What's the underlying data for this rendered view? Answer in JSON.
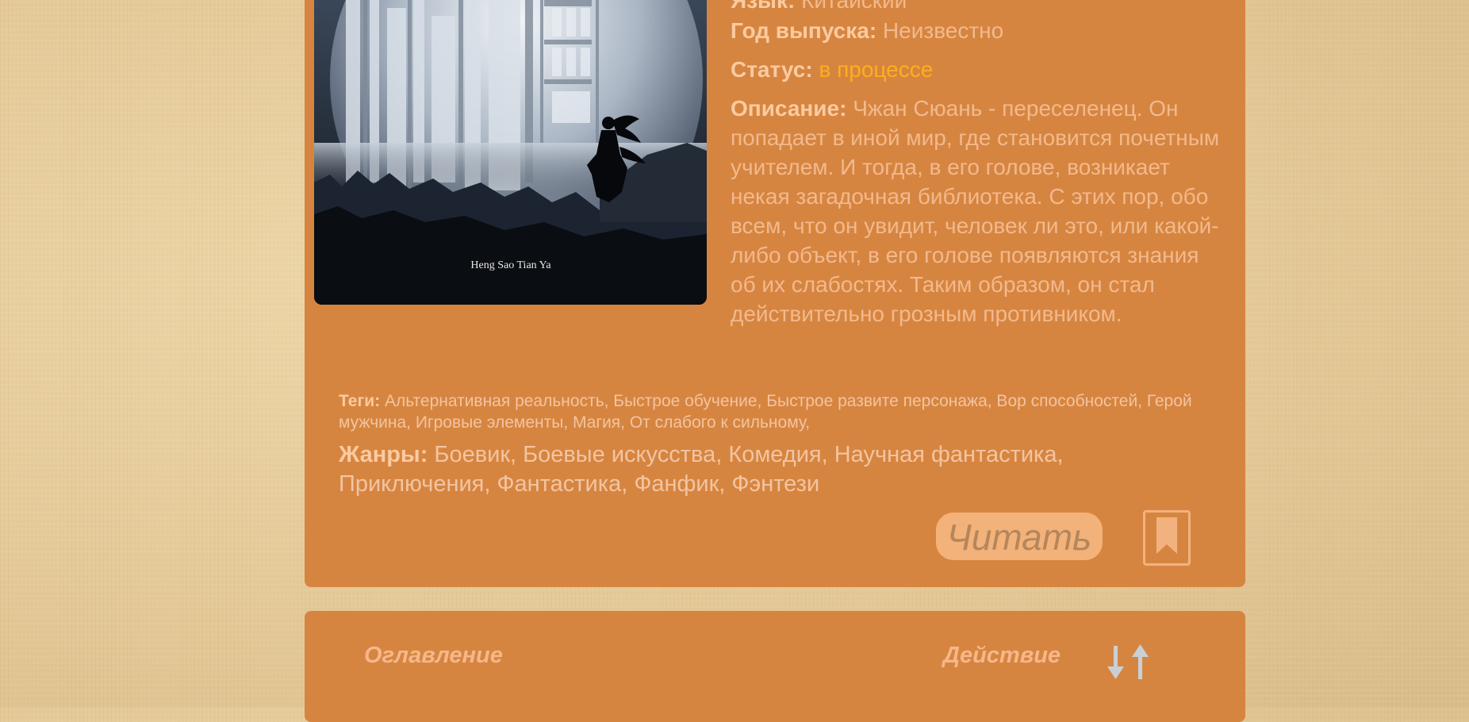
{
  "info": {
    "language_label": "Язык:",
    "language_value": "Китайский",
    "year_label": "Год выпуска:",
    "year_value": "Неизвестно",
    "status_label": "Статус:",
    "status_value": "в процессе",
    "description_label": "Описание:",
    "description_value": "Чжан Сюань - переселенец. Он попадает в иной мир, где становится почетным учителем. И тогда, в его голове, возникает некая загадочная библиотека. С этих пор, обо всем, что он увидит, человек ли это, или какой-либо объект, в его голове появляются знания об их слабостях. Таким образом, он стал действительно грозным противником."
  },
  "cover": {
    "caption": "Heng Sao Tian Ya"
  },
  "tags": {
    "label": "Теги:",
    "value": "Альтернативная реальность, Быстрое обучение, Быстрое развите персонажа, Вор способностей, Герой мужчина, Игровые элементы, Магия, От слабого к сильному,"
  },
  "genres": {
    "label": "Жанры:",
    "value": "Боевик, Боевые искусства, Комедия, Научная фантастика, Приключения, Фантастика, Фанфик, Фэнтези"
  },
  "actions": {
    "read_label": "Читать",
    "bookmark_icon": "bookmark-icon"
  },
  "toc": {
    "title": "Оглавление",
    "action_header": "Действие",
    "sort_icon": "sort-arrows-icon"
  },
  "colors": {
    "card": "#d68540",
    "status": "#ffad1f",
    "read_button": "#f3b27a"
  }
}
